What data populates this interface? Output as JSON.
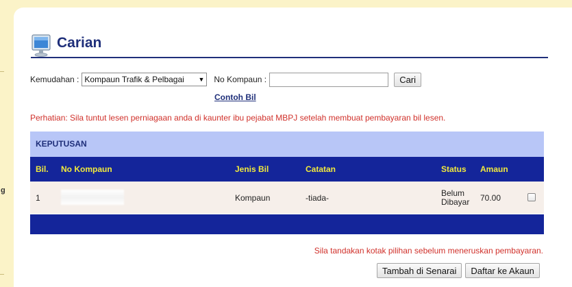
{
  "sidebar": {
    "partial_label": "g"
  },
  "header": {
    "title": "Carian",
    "icon": "monitor-icon"
  },
  "search": {
    "kemudahan_label": "Kemudahan :",
    "kemudahan_value": "Kompaun Trafik & Pelbagai",
    "no_kompaun_label": "No Kompaun :",
    "no_kompaun_value": "",
    "cari_label": "Cari"
  },
  "contoh_bil_label": "Contoh Bil",
  "notice": "Perhatian: Sila tuntut lesen perniagaan anda di kaunter ibu pejabat MBPJ setelah membuat pembayaran bil lesen.",
  "result": {
    "title": "KEPUTUSAN",
    "columns": [
      "Bil.",
      "No Kompaun",
      "Jenis Bil",
      "Catatan",
      "Status",
      "Amaun"
    ],
    "rows": [
      {
        "bil": "1",
        "no_kompaun": "",
        "jenis_bil": "Kompaun",
        "catatan": "-tiada-",
        "status_line1": "Belum",
        "status_line2": "Dibayar",
        "amaun": "70.00"
      }
    ]
  },
  "tick_notice": "Sila tandakan kotak pilihan sebelum meneruskan pembayaran.",
  "actions": {
    "add_label": "Tambah di Senarai",
    "register_label": "Daftar ke Akaun"
  },
  "colors": {
    "header_blue": "#14259a",
    "title_blue": "#1f2f7a",
    "alert_red": "#d0302a",
    "page_bg": "#fbf3c8"
  }
}
